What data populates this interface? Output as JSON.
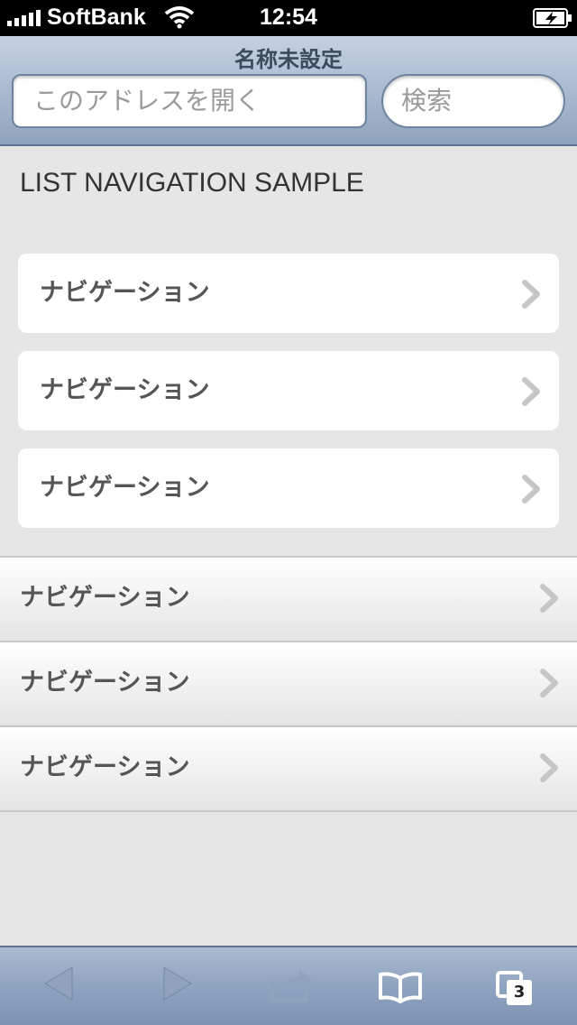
{
  "status_bar": {
    "carrier": "SoftBank",
    "time": "12:54",
    "icons": [
      "signal-icon",
      "wifi-icon",
      "battery-charging-icon"
    ]
  },
  "browser": {
    "page_title": "名称未設定",
    "address_placeholder": "このアドレスを開く",
    "search_placeholder": "検索"
  },
  "content": {
    "heading": "LIST NAVIGATION SAMPLE",
    "card_items": [
      {
        "label": "ナビゲーション"
      },
      {
        "label": "ナビゲーション"
      },
      {
        "label": "ナビゲーション"
      }
    ],
    "list_items": [
      {
        "label": "ナビゲーション"
      },
      {
        "label": "ナビゲーション"
      },
      {
        "label": "ナビゲーション"
      }
    ]
  },
  "toolbar": {
    "tab_count": "3",
    "icons": [
      "back-arrow-icon",
      "forward-arrow-icon",
      "share-icon",
      "bookmarks-icon",
      "tabs-icon"
    ]
  }
}
